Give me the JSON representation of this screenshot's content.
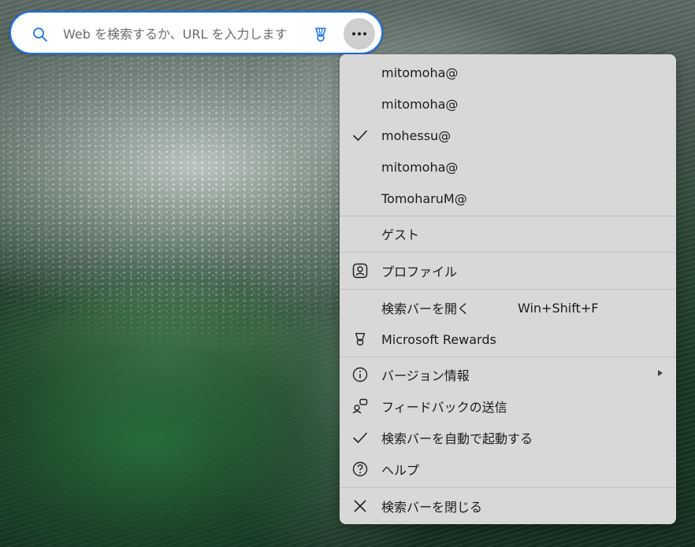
{
  "search": {
    "placeholder": "Web を検索するか、URL を入力します",
    "value": ""
  },
  "icons": {
    "search": "search-icon",
    "rewards": "trophy-icon",
    "more": "more-dots-icon"
  },
  "colors": {
    "accent": "#1a73e8",
    "menu_bg": "#d8d8d8",
    "more_button_bg": "#cfcfcf"
  },
  "menu": {
    "accounts": [
      {
        "label": "mitomoha@",
        "checked": false
      },
      {
        "label": "mitomoha@",
        "checked": false
      },
      {
        "label": "mohessu@",
        "checked": true
      },
      {
        "label": "mitomoha@",
        "checked": false
      },
      {
        "label": "TomoharuM@",
        "checked": false
      }
    ],
    "guest": "ゲスト",
    "profile": "プロファイル",
    "open_search_bar": {
      "label": "検索バーを開く",
      "shortcut": "Win+Shift+F"
    },
    "rewards": "Microsoft Rewards",
    "version_info": "バージョン情報",
    "feedback": "フィードバックの送信",
    "auto_start": {
      "label": "検索バーを自動で起動する",
      "checked": true
    },
    "help": "ヘルプ",
    "close_search_bar": "検索バーを閉じる"
  }
}
